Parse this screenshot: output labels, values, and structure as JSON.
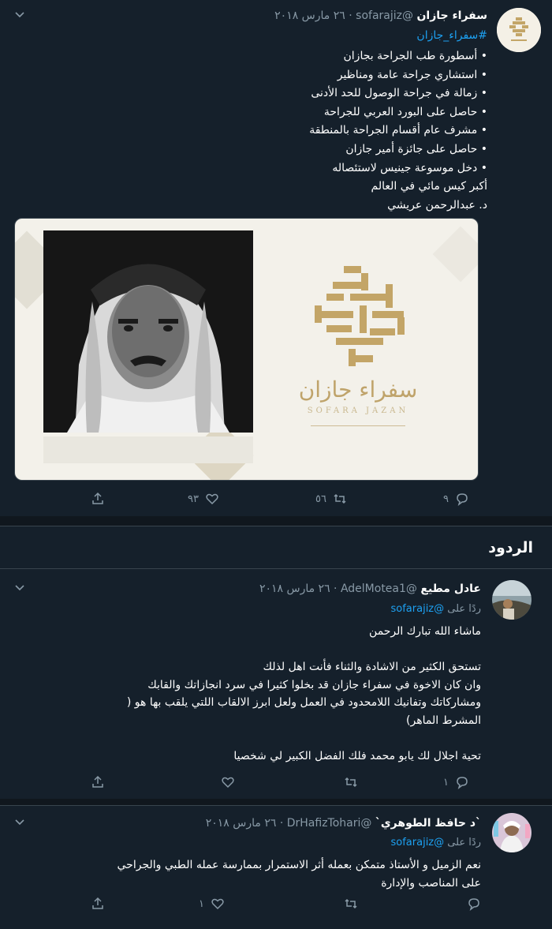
{
  "tweet": {
    "author_name": "سفراء جازان",
    "handle": "@sofarajiz",
    "date": "٢٦ مارس ٢٠١٨",
    "hashtag": "#سفراء_جازان",
    "lines": [
      "• أسطورة طب الجراحة بجازان",
      "• استشاري جراحة عامة ومناظير",
      "• زمالة في جراحة الوصول للحد الأدنى",
      "• حاصل على البورد العربي للجراحة",
      "• مشرف عام أقسام الجراحة بالمنطقة",
      "• حاصل على جائزة أمير جازان",
      "• دخل موسوعة جينيس لاستئصاله",
      "أكبر كيس مائي في العالم",
      "د. عبدالرحمن عريشي"
    ],
    "media": {
      "logo_text_ar": "سفراء جازان",
      "logo_text_en": "SOFARA JAZAN"
    },
    "counts": {
      "replies": "٩",
      "retweets": "٥٦",
      "likes": "٩٣"
    }
  },
  "replies_section": {
    "title": "الردود"
  },
  "replies": [
    {
      "author_name": "عادل مطيع",
      "handle": "@AdelMotea1",
      "date": "٢٦ مارس ٢٠١٨",
      "replying_to_label": "ردًا على",
      "replying_to": "@sofarajiz",
      "lines": [
        "ماشاء الله تبارك الرحمن",
        "",
        "تستحق الكثير من الاشادة والثناء فأنت اهل لذلك",
        "وان كان الاخوة في سفراء جازان قد بخلوا كثيرا في سرد انجازاتك والقابك",
        "ومشاركاتك وتفانيك اللامحدود في العمل ولعل ابرز الالقاب اللتي يلقب بها هو (",
        "المشرط الماهر)",
        "",
        "تحية اجلال لك يابو محمد فلك الفضل الكبير لي شخصيا"
      ],
      "counts": {
        "replies": "١",
        "retweets": "",
        "likes": ""
      }
    },
    {
      "author_name": "`د حافظ الطوهري`",
      "handle": "@DrHafizTohari",
      "date": "٢٦ مارس ٢٠١٨",
      "replying_to_label": "ردًا على",
      "replying_to": "@sofarajiz",
      "lines": [
        "نعم الزميل و الأستاذ متمكن بعمله أثر الاستمرار بممارسة عمله الطبي والجراحي",
        "على المناصب والإدارة"
      ],
      "counts": {
        "replies": "",
        "retweets": "",
        "likes": "١"
      }
    }
  ],
  "icons": {
    "more": "chevron-down-icon",
    "reply": "comment-icon",
    "retweet": "retweet-icon",
    "like": "heart-icon",
    "share": "share-icon"
  },
  "colors": {
    "background": "#15202b",
    "secondary_text": "#8899a6",
    "link": "#1da1f2",
    "divider": "#38444d",
    "logo_gold": "#bfa36a"
  }
}
